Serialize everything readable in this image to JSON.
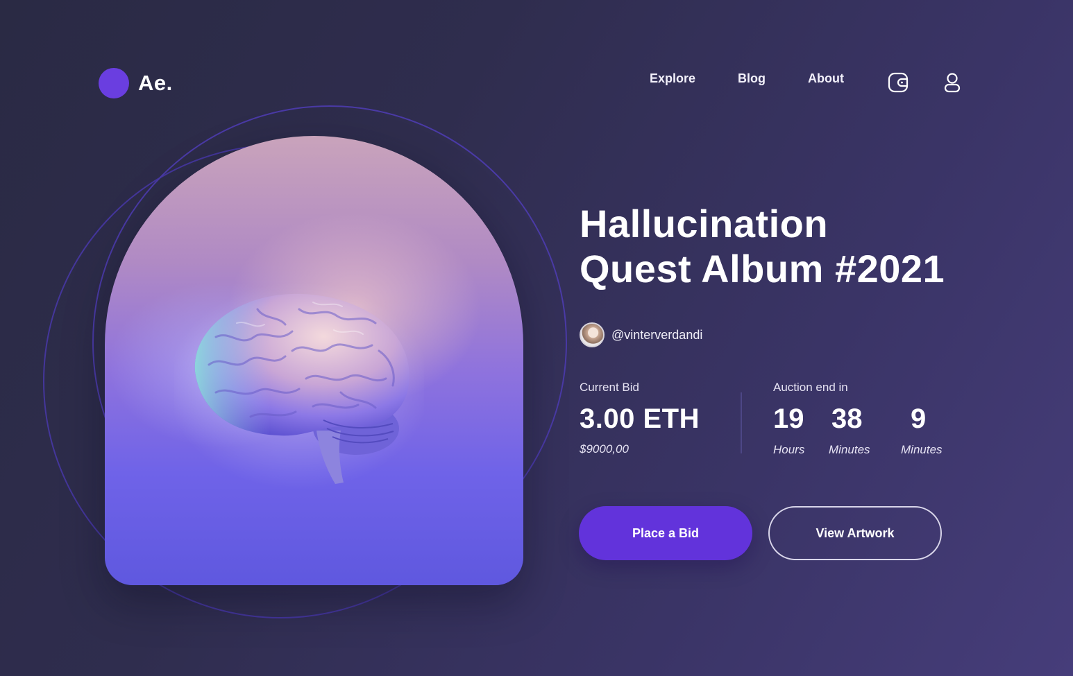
{
  "brand": {
    "logo_text": "Ae."
  },
  "nav": {
    "links": [
      "Explore",
      "Blog",
      "About"
    ],
    "icons": [
      "wallet-icon",
      "user-icon"
    ]
  },
  "hero": {
    "title_line1": "Hallucination",
    "title_line2": "Quest Album #2021",
    "creator_handle": "@vinterverdandi"
  },
  "bid": {
    "label": "Current Bid",
    "value": "3.00 ETH",
    "usd": "$9000,00"
  },
  "auction": {
    "label": "Auction end in",
    "countdown": [
      {
        "value": "19",
        "unit": "Hours"
      },
      {
        "value": "38",
        "unit": "Minutes"
      },
      {
        "value": "9",
        "unit": "Minutes"
      }
    ]
  },
  "actions": {
    "primary": "Place a Bid",
    "secondary": "View Artwork"
  },
  "colors": {
    "accent": "#6233db",
    "logo": "#6a3ee0",
    "background_start": "#2a2a44",
    "background_end": "#463d7a"
  }
}
